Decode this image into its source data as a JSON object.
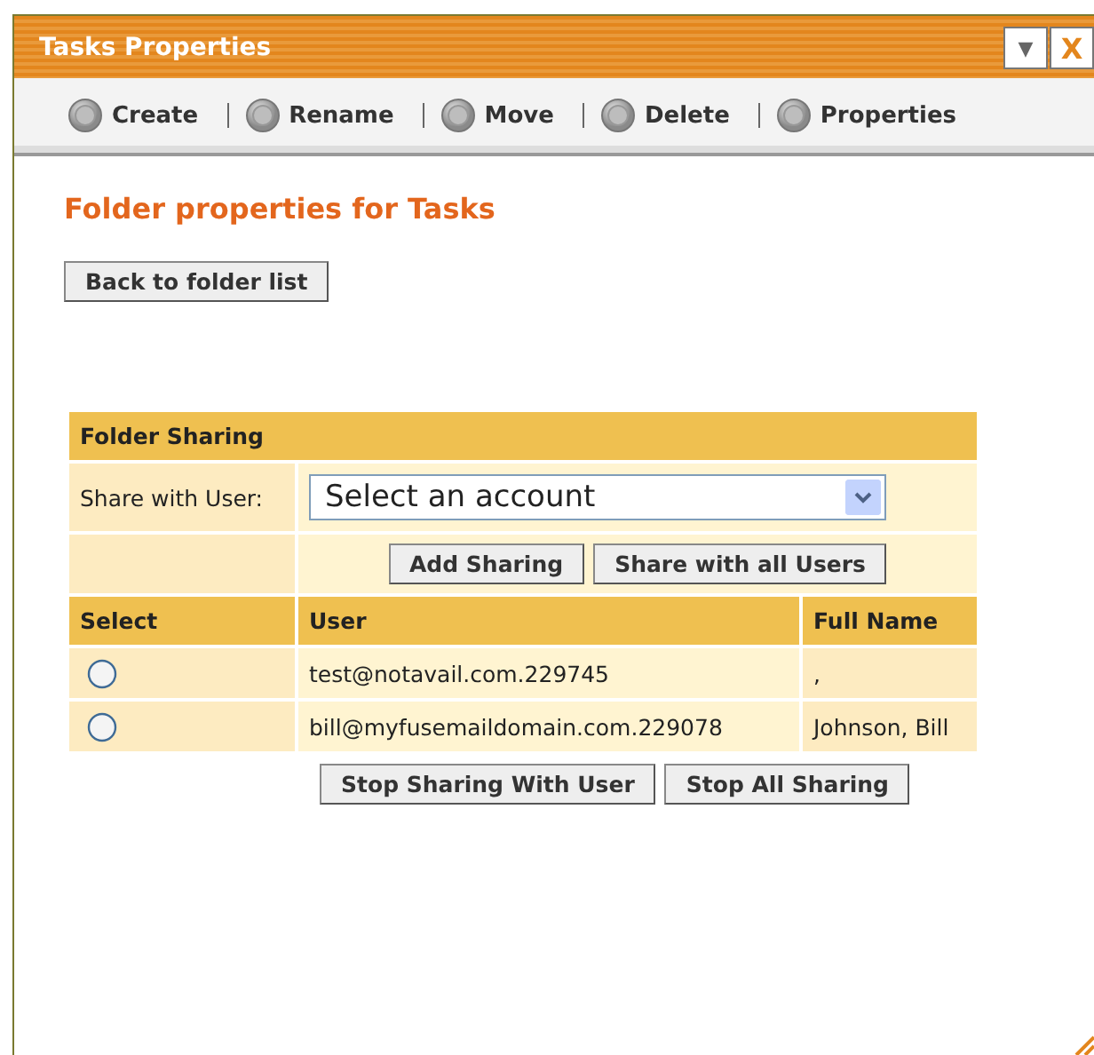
{
  "window": {
    "title": "Tasks Properties",
    "buttons": [
      {
        "label": "▼",
        "kind": "menu"
      },
      {
        "label": "X",
        "kind": "close"
      }
    ]
  },
  "toolbar": [
    {
      "label": "Create"
    },
    {
      "label": "Rename"
    },
    {
      "label": "Move"
    },
    {
      "label": "Delete"
    },
    {
      "label": "Properties"
    }
  ],
  "heading": "Folder properties for Tasks",
  "back_button": "Back to folder list",
  "sharing": {
    "title": "Folder Sharing",
    "share_label": "Share with User:",
    "account_select": {
      "value": "Select an account"
    },
    "buttons": [
      "Add Sharing",
      "Share with all Users"
    ],
    "columns": [
      "Select",
      "User",
      "Full Name"
    ],
    "rows": [
      {
        "selected": false,
        "user": "test@notavail.com.229745",
        "full_name": ","
      },
      {
        "selected": false,
        "user": "bill@myfusemaildomain.com.229078",
        "full_name": "Johnson, Bill"
      }
    ],
    "bottom_buttons": [
      "Stop Sharing With User",
      "Stop All Sharing"
    ]
  }
}
